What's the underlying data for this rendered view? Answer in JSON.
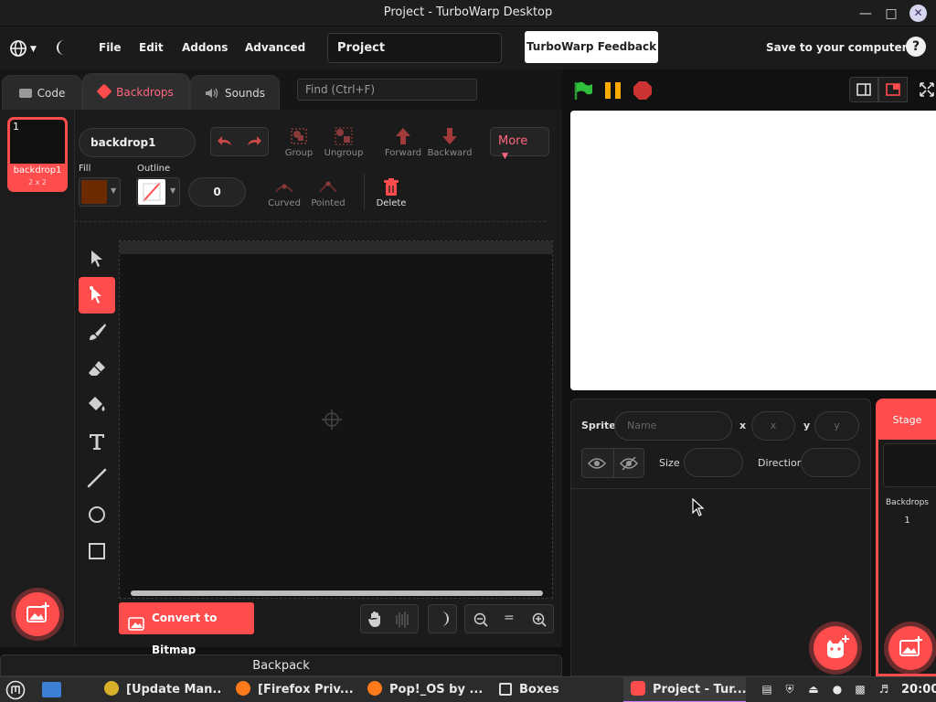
{
  "window": {
    "title": "Project - TurboWarp Desktop"
  },
  "menubar": {
    "items": [
      "File",
      "Edit",
      "Addons",
      "Advanced"
    ],
    "project_title": "Project",
    "feedback": "TurboWarp Feedback",
    "save": "Save to your computer"
  },
  "tabs": [
    {
      "label": "Code",
      "icon": "code-icon"
    },
    {
      "label": "Backdrops",
      "icon": "brush-icon"
    },
    {
      "label": "Sounds",
      "icon": "speaker-icon"
    }
  ],
  "find_placeholder": "Find (Ctrl+F)",
  "backdrop_list": {
    "number": "1",
    "name": "backdrop1",
    "size": "2 x 2"
  },
  "paint": {
    "name": "backdrop1",
    "group": "Group",
    "ungroup": "Ungroup",
    "forward": "Forward",
    "backward": "Backward",
    "more": "More",
    "fill_label": "Fill",
    "outline_label": "Outline",
    "outline_width": "0",
    "curved": "Curved",
    "pointed": "Pointed",
    "delete": "Delete",
    "convert": "Convert to Bitmap",
    "fill_color": "#6b2a00"
  },
  "backpack": "Backpack",
  "sprite_info": {
    "sprite_label": "Sprite",
    "name_placeholder": "Name",
    "x_label": "x",
    "x_placeholder": "x",
    "y_label": "y",
    "y_placeholder": "y",
    "size_label": "Size",
    "direction_label": "Direction"
  },
  "stage_pane": {
    "title": "Stage",
    "backdrops_label": "Backdrops",
    "backdrops_count": "1"
  },
  "taskbar": {
    "tasks": [
      "[Update Man...",
      "[Firefox Priv...",
      "Pop!_OS by ...",
      "Boxes",
      "Project - Tur..."
    ],
    "clock": "20:00"
  },
  "colors": {
    "accent": "#ff4c4c",
    "tab_active_text": "#ff6680",
    "green_flag": "#2fbf3c",
    "pause": "#ffaa00",
    "stop": "#cc3333"
  }
}
